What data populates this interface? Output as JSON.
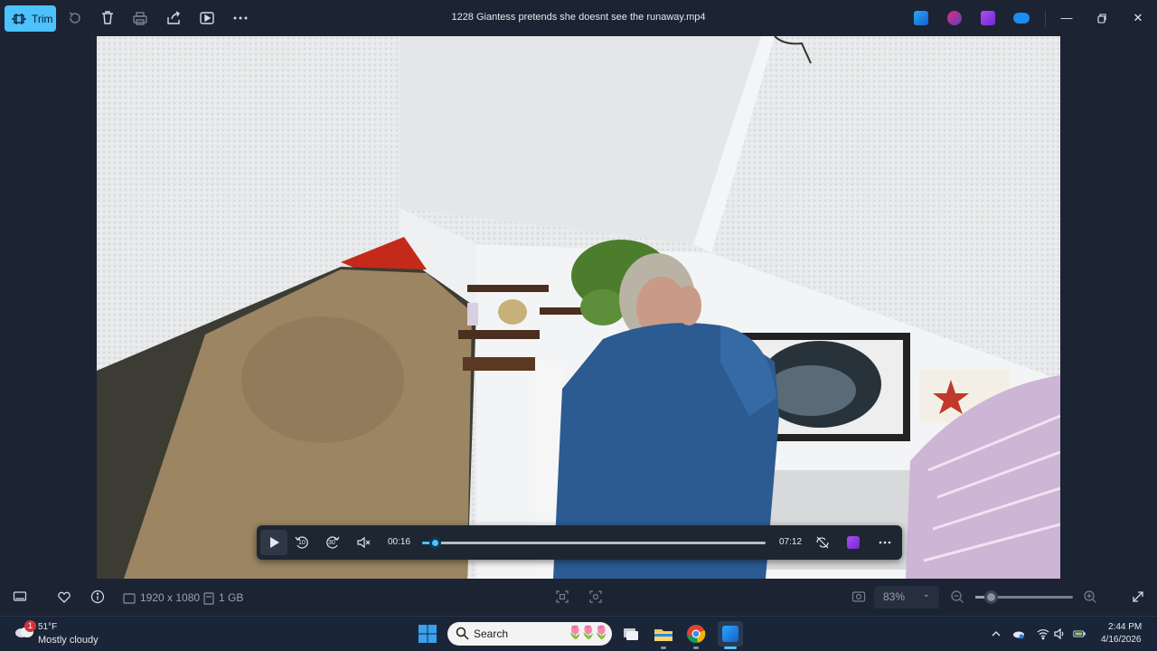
{
  "app": {
    "title": "1228 Giantess pretends she doesnt see the runaway.mp4"
  },
  "toolbar": {
    "trim_label": "Trim"
  },
  "player": {
    "current_time": "00:16",
    "duration": "07:12",
    "progress_fraction": 0.037,
    "skip_back_label": "10",
    "skip_forward_label": "30"
  },
  "status": {
    "resolution": "1920 x 1080",
    "file_size": "1 GB",
    "zoom": "83%",
    "zoom_slider_fraction": 0.16
  },
  "taskbar": {
    "weather_temp": "51°F",
    "weather_desc": "Mostly cloudy",
    "weather_badge": "1",
    "search_placeholder": "Search",
    "time": "2:44 PM",
    "date": "4/16/2026"
  },
  "colors": {
    "accent": "#4cc2ff",
    "background": "#1c2433",
    "taskbar": "#1a2638"
  }
}
